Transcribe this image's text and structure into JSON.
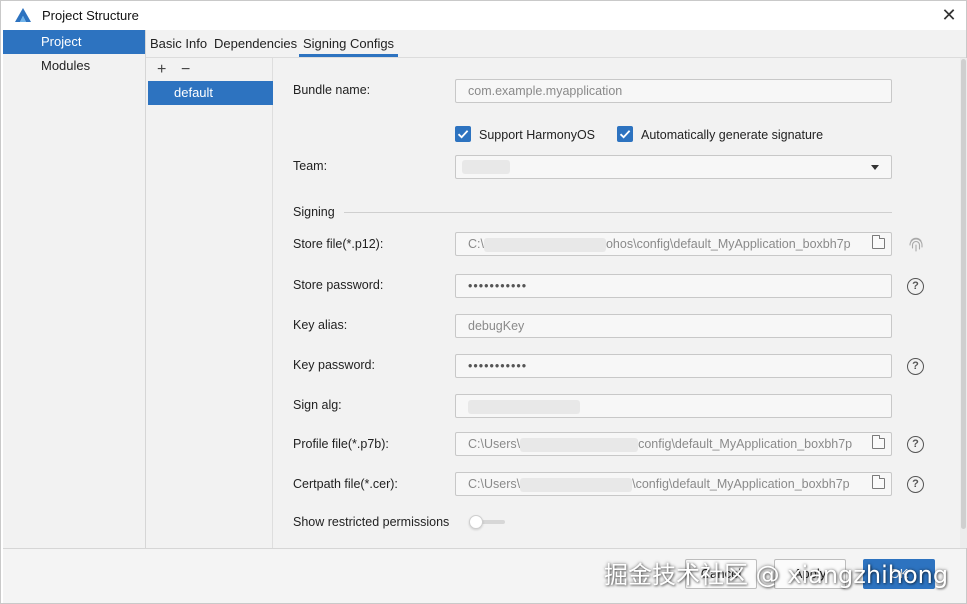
{
  "window": {
    "title": "Project Structure",
    "close_glyph": "✕"
  },
  "nav": {
    "items": [
      {
        "label": "Project",
        "selected": true
      },
      {
        "label": "Modules",
        "selected": false
      }
    ]
  },
  "tabs": [
    {
      "label": "Basic Info"
    },
    {
      "label": "Dependencies"
    },
    {
      "label": "Signing Configs",
      "active": true
    }
  ],
  "configs": {
    "add_glyph": "+",
    "remove_glyph": "−",
    "items": [
      {
        "label": "default"
      }
    ]
  },
  "form": {
    "bundle_name_label": "Bundle name:",
    "bundle_name_placeholder": "com.example.myapplication",
    "support_harmonyos": {
      "label": "Support HarmonyOS",
      "checked": true
    },
    "auto_sign": {
      "label": "Automatically generate signature",
      "checked": true
    },
    "team_label": "Team:",
    "signing_section": "Signing",
    "store_file_label": "Store file(*.p12):",
    "store_file_prefix": "C:\\",
    "store_file_suffix": "ohos\\config\\default_MyApplication_boxbh7p",
    "store_password_label": "Store password:",
    "store_password_value": "•••••••••••",
    "key_alias_label": "Key alias:",
    "key_alias_value": "debugKey",
    "key_password_label": "Key password:",
    "key_password_value": "•••••••••••",
    "sign_alg_label": "Sign alg:",
    "profile_file_label": "Profile file(*.p7b):",
    "profile_file_prefix": "C:\\Users\\",
    "profile_file_suffix": "config\\default_MyApplication_boxbh7p",
    "certpath_file_label": "Certpath file(*.cer):",
    "certpath_file_prefix": "C:\\Users\\",
    "certpath_file_suffix": "\\config\\default_MyApplication_boxbh7p",
    "show_restricted_label": "Show restricted permissions",
    "show_restricted_on": false,
    "help_glyph": "?"
  },
  "footer": {
    "cancel_label": "Cancel",
    "apply_label": "Apply",
    "ok_label": "OK"
  },
  "watermark": "掘金技术社区 @ xiangzhihong",
  "colors": {
    "accent": "#2d73c0",
    "panel": "#f2f2f2"
  }
}
